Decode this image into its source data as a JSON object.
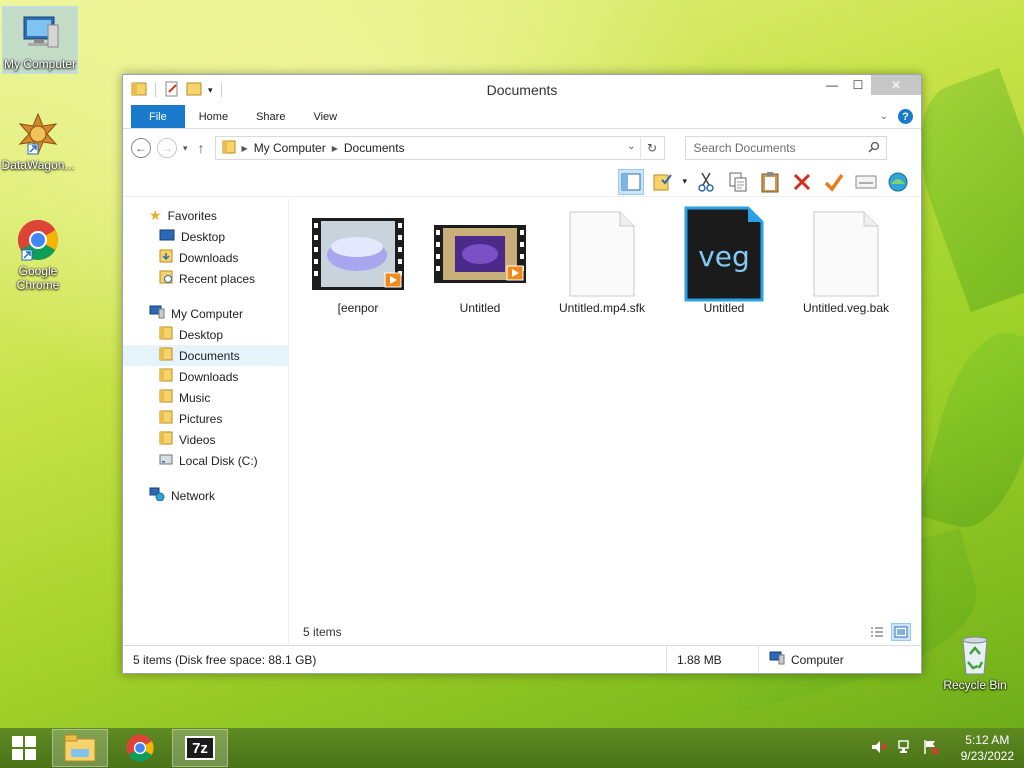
{
  "desktop": {
    "icons": [
      {
        "label": "My Computer"
      },
      {
        "label": "DataWagon..."
      },
      {
        "label": "Google Chrome"
      },
      {
        "label": "Recycle Bin"
      }
    ]
  },
  "window": {
    "title": "Documents",
    "tabs": [
      {
        "label": "File"
      },
      {
        "label": "Home"
      },
      {
        "label": "Share"
      },
      {
        "label": "View"
      }
    ],
    "address": {
      "crumbs": [
        "My Computer",
        "Documents"
      ]
    },
    "search": {
      "placeholder": "Search Documents"
    },
    "nav": {
      "favorites": {
        "label": "Favorites",
        "items": [
          "Desktop",
          "Downloads",
          "Recent places"
        ]
      },
      "computer": {
        "label": "My Computer",
        "items": [
          "Desktop",
          "Documents",
          "Downloads",
          "Music",
          "Pictures",
          "Videos",
          "Local Disk (C:)"
        ]
      },
      "network": {
        "label": "Network"
      }
    },
    "files": [
      {
        "name": "[eenpor",
        "type": "video"
      },
      {
        "name": "Untitled",
        "type": "video"
      },
      {
        "name": "Untitled.mp4.sfk",
        "type": "document"
      },
      {
        "name": "Untitled",
        "type": "veg",
        "icon_text": "veg"
      },
      {
        "name": "Untitled.veg.bak",
        "type": "document"
      }
    ],
    "item_count": "5 items",
    "status": {
      "summary": "5 items (Disk free space: 88.1 GB)",
      "size": "1.88 MB",
      "location": "Computer"
    }
  },
  "taskbar": {
    "apps": [
      "file-explorer",
      "chrome",
      "7zip"
    ],
    "sevenzip_label": "7z",
    "clock": {
      "time": "5:12 AM",
      "date": "9/23/2022"
    }
  },
  "colors": {
    "accent": "#1979ca",
    "selection": "#cce4f7",
    "taskbar": "#4b7418"
  }
}
